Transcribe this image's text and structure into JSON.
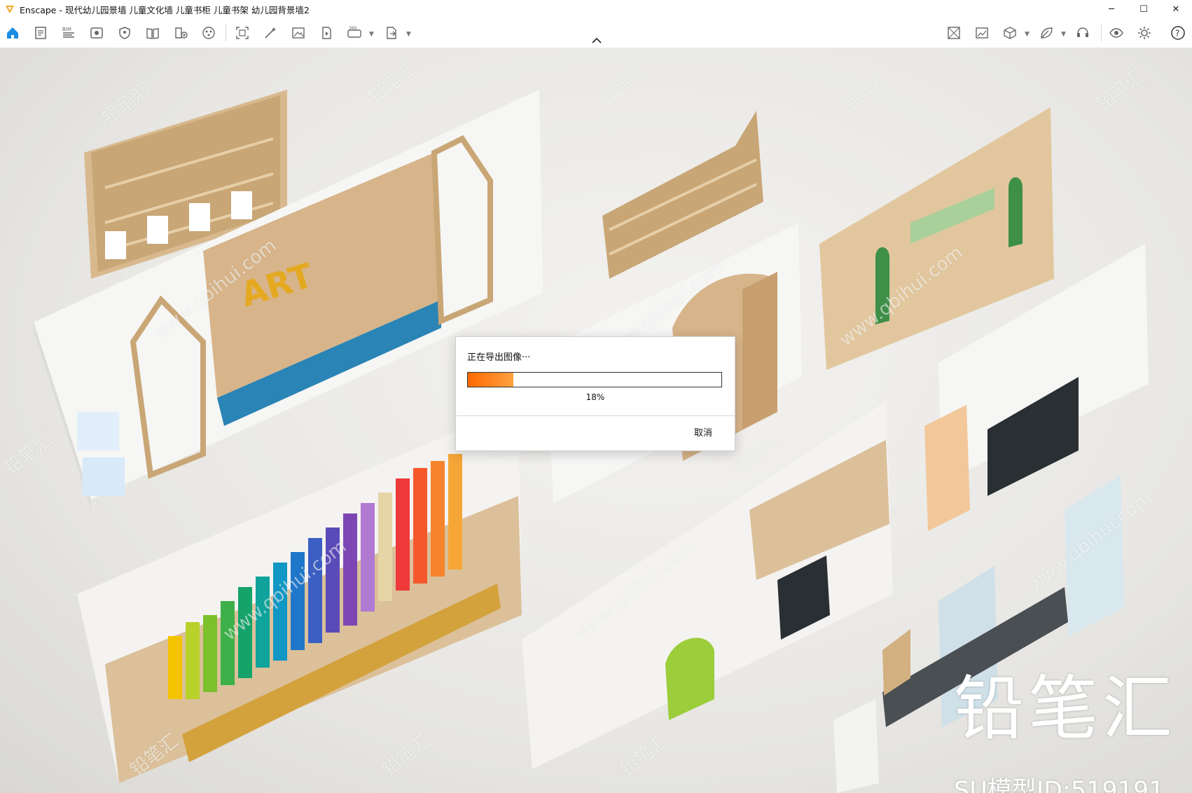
{
  "window": {
    "title": "Enscape - 现代幼儿园景墙 儿童文化墙 儿童书柜 儿童书架 幼儿园背景墙2",
    "controls": [
      "─",
      "☐",
      "✕"
    ]
  },
  "toolbar": {
    "left_icons": [
      "home-icon",
      "document-icon",
      "bim-icon",
      "eye-view-icon",
      "shield-icon",
      "book-icon",
      "asset-library-icon",
      "material-icon",
      "capture-icon",
      "magic-wand-icon",
      "image-icon",
      "render-video-icon",
      "panorama-360-icon",
      "export-icon"
    ],
    "bim_label": "BIM",
    "pano_label": "360",
    "right_icons": [
      "grid-view-icon",
      "image-compare-icon",
      "cube-icon",
      "leaf-icon",
      "headset-icon",
      "visibility-icon",
      "settings-icon",
      "help-icon"
    ]
  },
  "scene": {
    "art_sign": "ART",
    "brand_text": "铅笔汇",
    "model_id": "SU模型ID:519191",
    "watermark_text": "www.qbihui.com",
    "watermark_brand": "铅笔汇"
  },
  "dialog": {
    "title": "正在导出图像···",
    "progress": 0.18,
    "percent_label": "18%",
    "cancel_label": "取消"
  },
  "colors": {
    "accent_blue": "#1a8ce3",
    "progress_orange": "#ff6a00"
  }
}
